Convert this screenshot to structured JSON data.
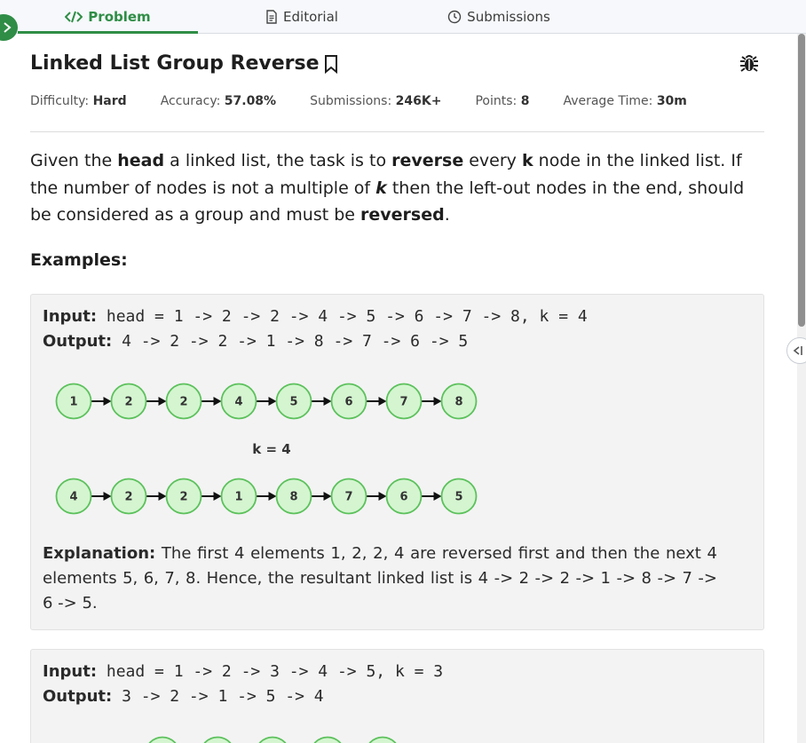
{
  "tabs": [
    {
      "label": "Problem",
      "icon": "code-icon",
      "active": true
    },
    {
      "label": "Editorial",
      "icon": "document-icon",
      "active": false
    },
    {
      "label": "Submissions",
      "icon": "clock-icon",
      "active": false
    }
  ],
  "problem": {
    "title": "Linked List Group Reverse",
    "meta": {
      "difficulty_label": "Difficulty:",
      "difficulty": "Hard",
      "accuracy_label": "Accuracy:",
      "accuracy": "57.08%",
      "submissions_label": "Submissions:",
      "submissions": "246K+",
      "points_label": "Points:",
      "points": "8",
      "avg_time_label": "Average Time:",
      "avg_time": "30m"
    },
    "statement": {
      "p1": "Given the ",
      "b1": "head",
      "p2": " a linked list, the task is to ",
      "b2": "reverse",
      "p3": " every ",
      "b3": "k",
      "p4": " node in the linked list. If the number of nodes is not a multiple of ",
      "b4": "k",
      "p5": " then the left-out nodes in the end, should be considered as a group and must be ",
      "b5": "reversed",
      "p6": "."
    },
    "examples_heading": "Examples:"
  },
  "examples": [
    {
      "input_label": "Input:",
      "input": " head = 1 -> 2 -> 2 -> 4 -> 5 -> 6 -> 7 -> 8, k = 4",
      "output_label": "Output:",
      "output": " 4 -> 2 -> 2 -> 1 -> 8 -> 7 -> 6 -> 5",
      "diagram": {
        "before": [
          "1",
          "2",
          "2",
          "4",
          "5",
          "6",
          "7",
          "8"
        ],
        "k_label": "k = 4",
        "after": [
          "4",
          "2",
          "2",
          "1",
          "8",
          "7",
          "6",
          "5"
        ]
      },
      "explanation_label": "Explanation:",
      "explanation": " The first 4 elements 1, 2, 2, 4 are reversed first and then the next 4 elements 5, 6, 7, 8. Hence, the resultant linked list is 4 -> 2 -> 2 -> 1 -> 8 -> 7 -> 6 -> 5."
    },
    {
      "input_label": "Input:",
      "input": " head = 1 -> 2 -> 3 -> 4 -> 5, k = 3",
      "output_label": "Output:",
      "output": " 3 -> 2 -> 1 -> 5 -> 4"
    }
  ],
  "colors": {
    "accent": "#2f8d46",
    "node_fill": "#d4f5d0",
    "node_stroke": "#5cc15c"
  }
}
